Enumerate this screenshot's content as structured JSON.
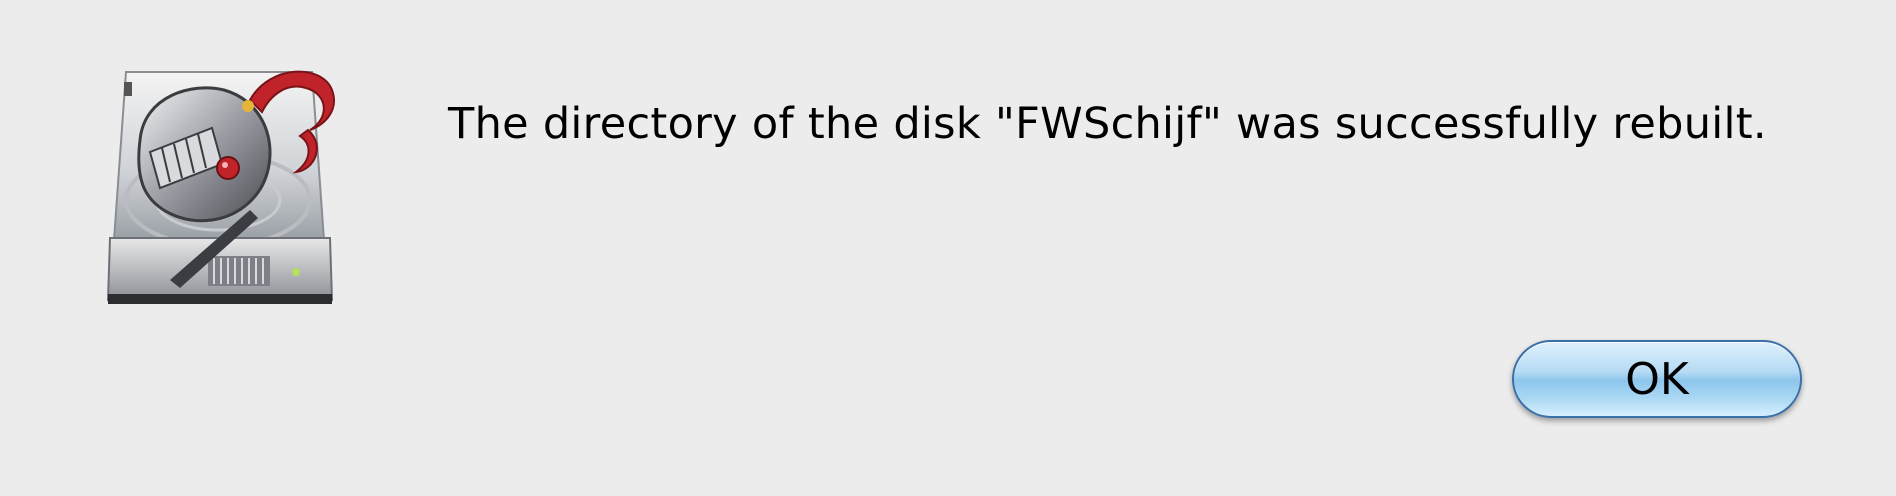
{
  "dialog": {
    "message": "The directory of the disk \"FWSchijf\" was successfully rebuilt.",
    "icon": "disk-repair-knight-icon",
    "ok_label": "OK"
  },
  "colors": {
    "background": "#ececec",
    "button_blue": "#8ec6ec",
    "button_border": "#3b6fa8",
    "plume_red": "#c0242a"
  }
}
